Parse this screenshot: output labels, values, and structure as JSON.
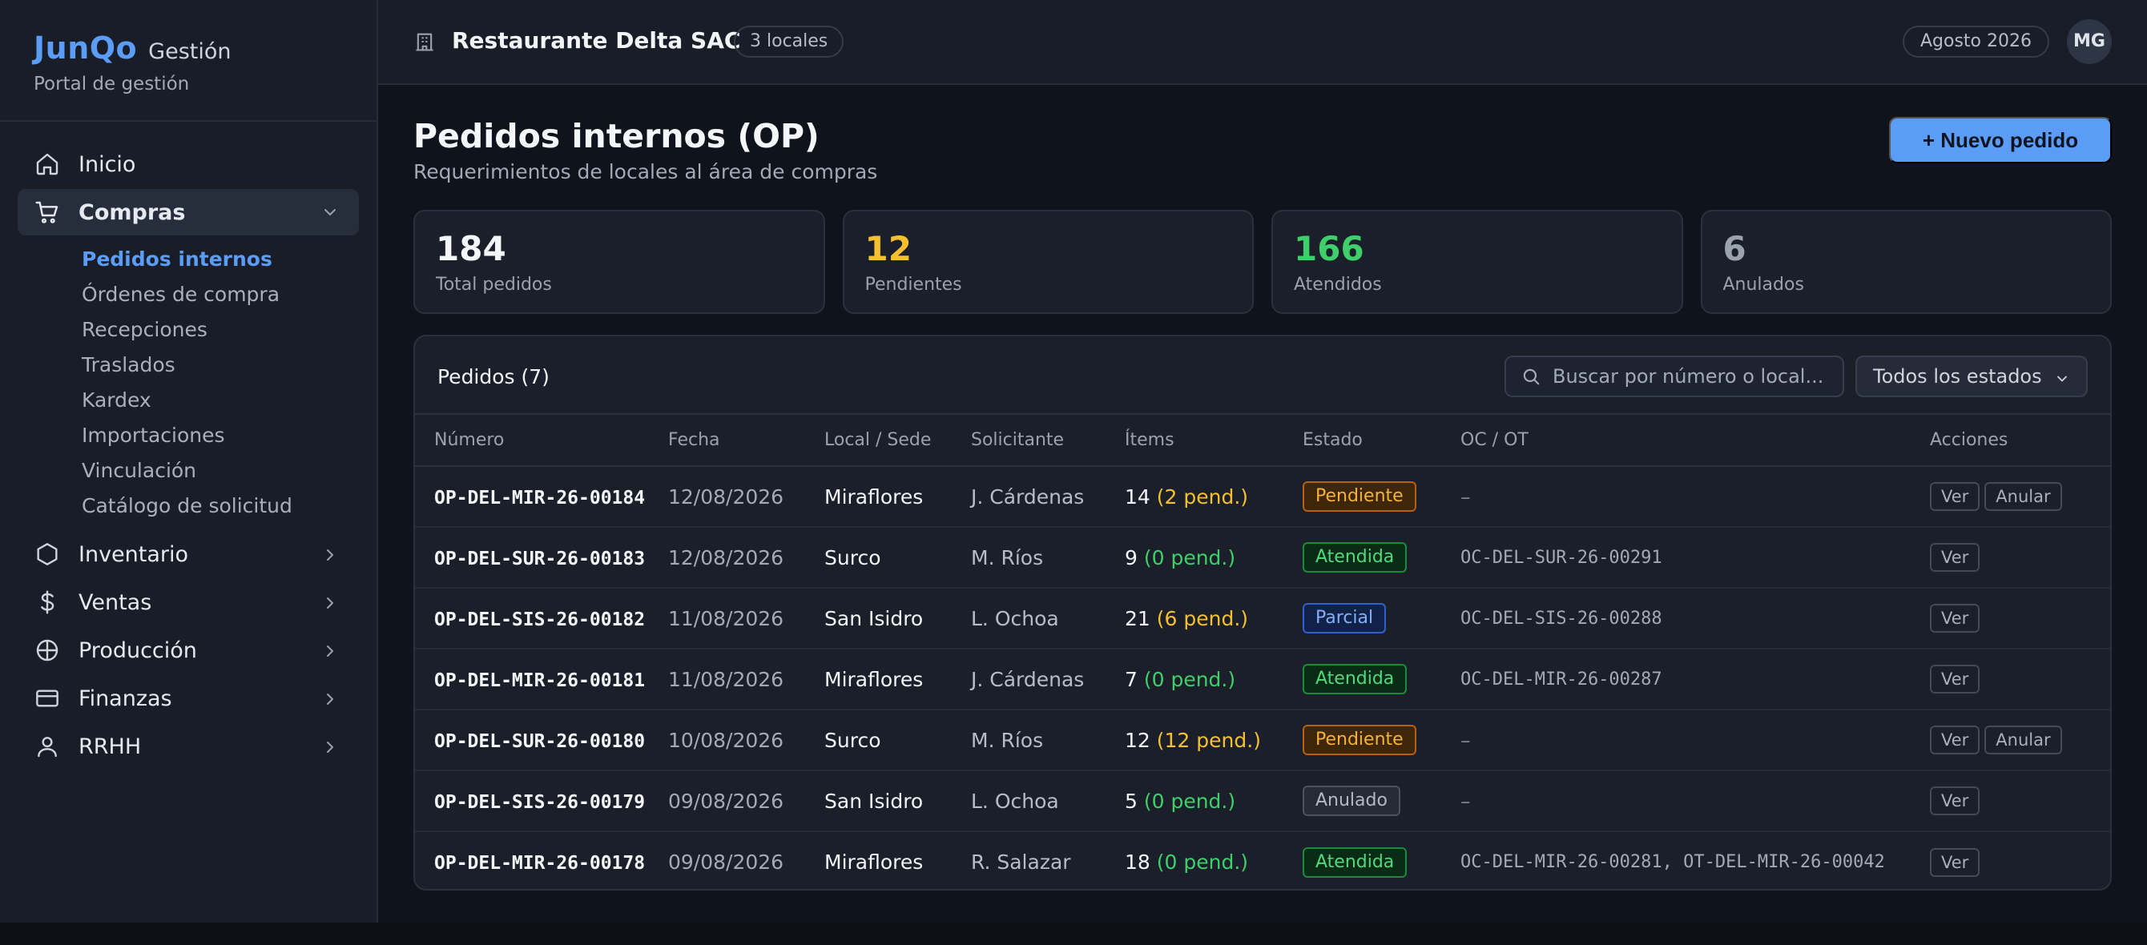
{
  "brand": {
    "name": "JunQo",
    "suffix": "Gestión",
    "subtitle": "Portal de gestión"
  },
  "sidebar": {
    "items": [
      {
        "label": "Inicio",
        "icon": "home-icon"
      },
      {
        "label": "Compras",
        "icon": "cart-icon",
        "active": true,
        "expanded": true
      }
    ],
    "compras_sub": [
      {
        "label": "Pedidos internos",
        "active": true
      },
      {
        "label": "Órdenes de compra"
      },
      {
        "label": "Recepciones"
      },
      {
        "label": "Traslados"
      },
      {
        "label": "Kardex"
      },
      {
        "label": "Importaciones"
      },
      {
        "label": "Vinculación"
      },
      {
        "label": "Catálogo de solicitud"
      }
    ],
    "groups": [
      {
        "label": "Inventario",
        "icon": "box-icon"
      },
      {
        "label": "Ventas",
        "icon": "dollar-icon"
      },
      {
        "label": "Producción",
        "icon": "globe-icon"
      },
      {
        "label": "Finanzas",
        "icon": "card-icon"
      },
      {
        "label": "RRHH",
        "icon": "user-icon"
      }
    ]
  },
  "topbar": {
    "org_name": "Restaurante Delta SAC",
    "locales_badge": "3 locales",
    "period": "Agosto 2026",
    "avatar_initials": "MG"
  },
  "page": {
    "title": "Pedidos internos (OP)",
    "subtitle": "Requerimientos de locales al área de compras",
    "new_button": "+ Nuevo pedido"
  },
  "stats": [
    {
      "value": "184",
      "label": "Total pedidos",
      "color": "#f4f6f9"
    },
    {
      "value": "12",
      "label": "Pendientes",
      "color": "#f5c030"
    },
    {
      "value": "166",
      "label": "Atendidos",
      "color": "#3ecf6a"
    },
    {
      "value": "6",
      "label": "Anulados",
      "color": "#9aa2ae"
    }
  ],
  "panel": {
    "title": "Pedidos (7)",
    "search_placeholder": "Buscar por número o local...",
    "filter_value": "Todos los estados"
  },
  "table": {
    "headers": {
      "numero": "Número",
      "fecha": "Fecha",
      "local": "Local / Sede",
      "solicitante": "Solicitante",
      "items": "Ítems",
      "estado": "Estado",
      "oc": "OC / OT",
      "acciones": "Acciones"
    },
    "rows": [
      {
        "numero": "OP-DEL-MIR-26-00184",
        "fecha": "12/08/2026",
        "local": "Miraflores",
        "solicitante": "J. Cárdenas",
        "items": "14",
        "pend": "(2 pend.)",
        "estado": "Pendiente",
        "oc": "–",
        "acciones": [
          "Ver",
          "Anular"
        ]
      },
      {
        "numero": "OP-DEL-SUR-26-00183",
        "fecha": "12/08/2026",
        "local": "Surco",
        "solicitante": "M. Ríos",
        "items": "9",
        "pend": "(0 pend.)",
        "estado": "Atendida",
        "oc": "OC-DEL-SUR-26-00291",
        "acciones": [
          "Ver"
        ]
      },
      {
        "numero": "OP-DEL-SIS-26-00182",
        "fecha": "11/08/2026",
        "local": "San Isidro",
        "solicitante": "L. Ochoa",
        "items": "21",
        "pend": "(6 pend.)",
        "estado": "Parcial",
        "oc": "OC-DEL-SIS-26-00288",
        "acciones": [
          "Ver"
        ]
      },
      {
        "numero": "OP-DEL-MIR-26-00181",
        "fecha": "11/08/2026",
        "local": "Miraflores",
        "solicitante": "J. Cárdenas",
        "items": "7",
        "pend": "(0 pend.)",
        "estado": "Atendida",
        "oc": "OC-DEL-MIR-26-00287",
        "acciones": [
          "Ver"
        ]
      },
      {
        "numero": "OP-DEL-SUR-26-00180",
        "fecha": "10/08/2026",
        "local": "Surco",
        "solicitante": "M. Ríos",
        "items": "12",
        "pend": "(12 pend.)",
        "estado": "Pendiente",
        "oc": "–",
        "acciones": [
          "Ver",
          "Anular"
        ]
      },
      {
        "numero": "OP-DEL-SIS-26-00179",
        "fecha": "09/08/2026",
        "local": "San Isidro",
        "solicitante": "L. Ochoa",
        "items": "5",
        "pend": "(0 pend.)",
        "estado": "Anulado",
        "oc": "–",
        "acciones": [
          "Ver"
        ]
      },
      {
        "numero": "OP-DEL-MIR-26-00178",
        "fecha": "09/08/2026",
        "local": "Miraflores",
        "solicitante": "R. Salazar",
        "items": "18",
        "pend": "(0 pend.)",
        "estado": "Atendida",
        "oc": "OC-DEL-MIR-26-00281, OT-DEL-MIR-26-00042",
        "acciones": [
          "Ver"
        ]
      }
    ]
  },
  "colors": {
    "accent": "#5b9cf6",
    "pending": "#f5c030",
    "success": "#3ecf6a",
    "muted": "#9aa2ae",
    "background": "#0f131b",
    "surface": "#1a1f2a"
  }
}
